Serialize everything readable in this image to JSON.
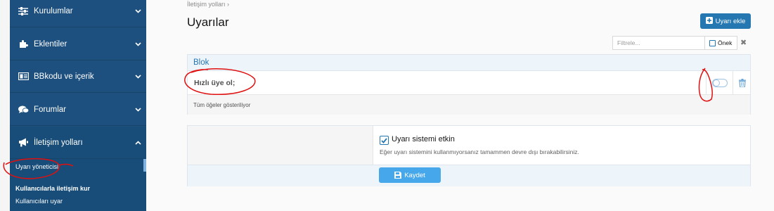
{
  "sidebar": {
    "items": [
      {
        "label": "Kurulumlar",
        "icon": "sliders-icon"
      },
      {
        "label": "Eklentiler",
        "icon": "puzzle-icon"
      },
      {
        "label": "BBkodu ve içerik",
        "icon": "bbcode-icon"
      },
      {
        "label": "Forumlar",
        "icon": "comments-icon"
      },
      {
        "label": "İletişim yolları",
        "icon": "bullhorn-icon"
      }
    ],
    "sub": [
      {
        "label": "Uyarı yöneticisi"
      },
      {
        "label": "Kullanıcılarla iletişim kur"
      },
      {
        "label": "Kullanıcıları uyar"
      }
    ]
  },
  "breadcrumb": "İletişim yolları",
  "page_title": "Uyarılar",
  "toolbar": {
    "add_label": "Uyarı ekle",
    "filter_placeholder": "Filtrele...",
    "prefix_label": "Önek"
  },
  "block": {
    "header": "Blok",
    "row_title": "Hızlı üye ol;",
    "footer_text": "Tüm öğeler gösteriliyor"
  },
  "settings": {
    "option_label": "Uyarı sistemi etkin",
    "option_hint": "Eğer uyarı sistemini kullanmıyorsanız tamammen devre dışı bırakabilirsiniz.",
    "save_label": "Kaydet"
  },
  "colors": {
    "sidebar": "#1d507f",
    "accent": "#2577b1",
    "save": "#47a7eb",
    "annotation": "#e01010"
  }
}
